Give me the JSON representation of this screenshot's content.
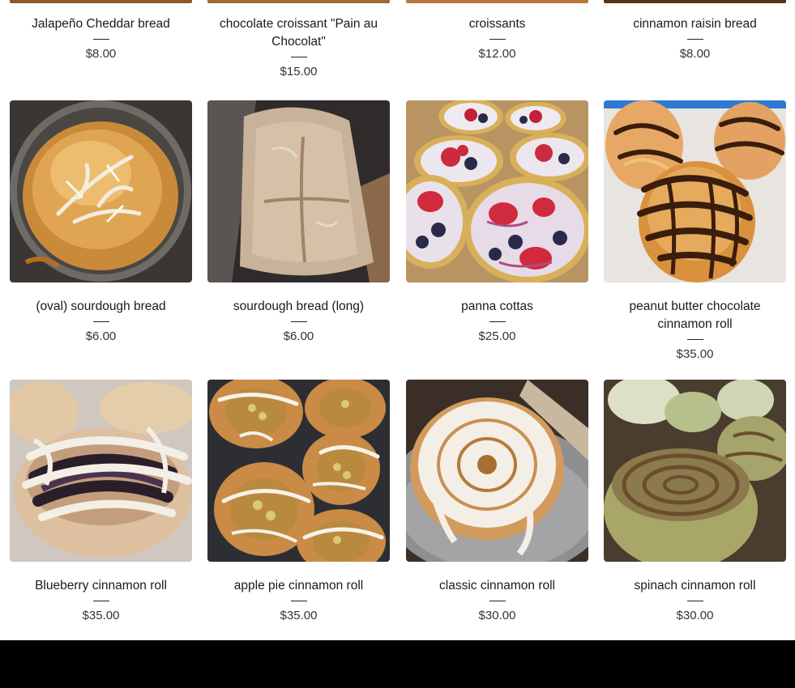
{
  "products": [
    {
      "name": "Jalapeño Cheddar bread",
      "price": "$8.00"
    },
    {
      "name": "chocolate croissant \"Pain au Chocolat\"",
      "price": "$15.00"
    },
    {
      "name": "croissants",
      "price": "$12.00"
    },
    {
      "name": "cinnamon raisin bread",
      "price": "$8.00"
    },
    {
      "name": "(oval) sourdough bread",
      "price": "$6.00"
    },
    {
      "name": "sourdough bread (long)",
      "price": "$6.00"
    },
    {
      "name": "panna cottas",
      "price": "$25.00"
    },
    {
      "name": "peanut butter chocolate cinnamon roll",
      "price": "$35.00"
    },
    {
      "name": "Blueberry cinnamon roll",
      "price": "$35.00"
    },
    {
      "name": "apple pie cinnamon roll",
      "price": "$35.00"
    },
    {
      "name": "classic cinnamon roll",
      "price": "$30.00"
    },
    {
      "name": "spinach cinnamon roll",
      "price": "$30.00"
    }
  ],
  "colors": {
    "footer": "#000000",
    "price_text": "#333333",
    "name_text": "#1a1a1a"
  }
}
